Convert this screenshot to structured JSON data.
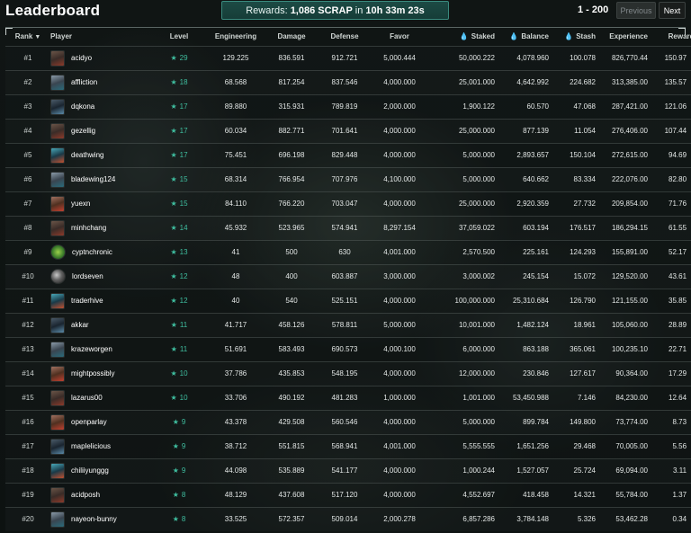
{
  "header": {
    "title": "Leaderboard",
    "rewards_prefix": "Rewards:",
    "rewards_amount": "1,086 SCRAP",
    "rewards_in": "in",
    "rewards_timer": "10h 33m 23s",
    "range": "1 - 200",
    "prev_label": "Previous",
    "next_label": "Next"
  },
  "columns": {
    "rank": "Rank",
    "player": "Player",
    "level": "Level",
    "engineering": "Engineering",
    "damage": "Damage",
    "defense": "Defense",
    "favor": "Favor",
    "staked": "Staked",
    "balance": "Balance",
    "stash": "Stash",
    "experience": "Experience",
    "rewards": "Rewards"
  },
  "icons": {
    "level": "star-icon",
    "token": "droplet-icon",
    "sort": "caret-down-icon"
  },
  "colors": {
    "accent": "#3fbfa0",
    "token": "#4a8ee8",
    "banner": "#1c4a44"
  },
  "rows": [
    {
      "rank": "#1",
      "player": "acidyo",
      "level": "29",
      "engineering": "129.225",
      "damage": "836.591",
      "defense": "912.721",
      "favor": "5,000.444",
      "staked": "50,000.222",
      "balance": "4,078.960",
      "stash": "100.078",
      "experience": "826,770.44",
      "rewards": "150.97"
    },
    {
      "rank": "#2",
      "player": "affliction",
      "level": "18",
      "engineering": "68.568",
      "damage": "817.254",
      "defense": "837.546",
      "favor": "4,000.000",
      "staked": "25,001.000",
      "balance": "4,642.992",
      "stash": "224.682",
      "experience": "313,385.00",
      "rewards": "135.57"
    },
    {
      "rank": "#3",
      "player": "dqkona",
      "level": "17",
      "engineering": "89.880",
      "damage": "315.931",
      "defense": "789.819",
      "favor": "2,000.000",
      "staked": "1,900.122",
      "balance": "60.570",
      "stash": "47.068",
      "experience": "287,421.00",
      "rewards": "121.06"
    },
    {
      "rank": "#4",
      "player": "gezellig",
      "level": "17",
      "engineering": "60.034",
      "damage": "882.771",
      "defense": "701.641",
      "favor": "4,000.000",
      "staked": "25,000.000",
      "balance": "877.139",
      "stash": "11.054",
      "experience": "276,406.00",
      "rewards": "107.44"
    },
    {
      "rank": "#5",
      "player": "deathwing",
      "level": "17",
      "engineering": "75.451",
      "damage": "696.198",
      "defense": "829.448",
      "favor": "4,000.000",
      "staked": "5,000.000",
      "balance": "2,893.657",
      "stash": "150.104",
      "experience": "272,615.00",
      "rewards": "94.69"
    },
    {
      "rank": "#6",
      "player": "bladewing124",
      "level": "15",
      "engineering": "68.314",
      "damage": "766.954",
      "defense": "707.976",
      "favor": "4,100.000",
      "staked": "5,000.000",
      "balance": "640.662",
      "stash": "83.334",
      "experience": "222,076.00",
      "rewards": "82.80"
    },
    {
      "rank": "#7",
      "player": "yuexn",
      "level": "15",
      "engineering": "84.110",
      "damage": "766.220",
      "defense": "703.047",
      "favor": "4,000.000",
      "staked": "25,000.000",
      "balance": "2,920.359",
      "stash": "27.732",
      "experience": "209,854.00",
      "rewards": "71.76"
    },
    {
      "rank": "#8",
      "player": "minhchang",
      "level": "14",
      "engineering": "45.932",
      "damage": "523.965",
      "defense": "574.941",
      "favor": "8,297.154",
      "staked": "37,059.022",
      "balance": "603.194",
      "stash": "176.517",
      "experience": "186,294.15",
      "rewards": "61.55"
    },
    {
      "rank": "#9",
      "player": "cyptnchronic",
      "level": "13",
      "engineering": "41",
      "damage": "500",
      "defense": "630",
      "favor": "4,001.000",
      "staked": "2,570.500",
      "balance": "225.161",
      "stash": "124.293",
      "experience": "155,891.00",
      "rewards": "52.17"
    },
    {
      "rank": "#10",
      "player": "lordseven",
      "level": "12",
      "engineering": "48",
      "damage": "400",
      "defense": "603.887",
      "favor": "3,000.000",
      "staked": "3,000.002",
      "balance": "245.154",
      "stash": "15.072",
      "experience": "129,520.00",
      "rewards": "43.61"
    },
    {
      "rank": "#11",
      "player": "traderhive",
      "level": "12",
      "engineering": "40",
      "damage": "540",
      "defense": "525.151",
      "favor": "4,000.000",
      "staked": "100,000.000",
      "balance": "25,310.684",
      "stash": "126.790",
      "experience": "121,155.00",
      "rewards": "35.85"
    },
    {
      "rank": "#12",
      "player": "akkar",
      "level": "11",
      "engineering": "41.717",
      "damage": "458.126",
      "defense": "578.811",
      "favor": "5,000.000",
      "staked": "10,001.000",
      "balance": "1,482.124",
      "stash": "18.961",
      "experience": "105,060.00",
      "rewards": "28.89"
    },
    {
      "rank": "#13",
      "player": "krazeworgen",
      "level": "11",
      "engineering": "51.691",
      "damage": "583.493",
      "defense": "690.573",
      "favor": "4,000.100",
      "staked": "6,000.000",
      "balance": "863.188",
      "stash": "365.061",
      "experience": "100,235.10",
      "rewards": "22.71"
    },
    {
      "rank": "#14",
      "player": "mightpossibly",
      "level": "10",
      "engineering": "37.786",
      "damage": "435.853",
      "defense": "548.195",
      "favor": "4,000.000",
      "staked": "12,000.000",
      "balance": "230.846",
      "stash": "127.617",
      "experience": "90,364.00",
      "rewards": "17.29"
    },
    {
      "rank": "#15",
      "player": "lazarus00",
      "level": "10",
      "engineering": "33.706",
      "damage": "490.192",
      "defense": "481.283",
      "favor": "1,000.000",
      "staked": "1,001.000",
      "balance": "53,450.988",
      "stash": "7.146",
      "experience": "84,230.00",
      "rewards": "12.64"
    },
    {
      "rank": "#16",
      "player": "openparlay",
      "level": "9",
      "engineering": "43.378",
      "damage": "429.508",
      "defense": "560.546",
      "favor": "4,000.000",
      "staked": "5,000.000",
      "balance": "899.784",
      "stash": "149.800",
      "experience": "73,774.00",
      "rewards": "8.73"
    },
    {
      "rank": "#17",
      "player": "maplelicious",
      "level": "9",
      "engineering": "38.712",
      "damage": "551.815",
      "defense": "568.941",
      "favor": "4,001.000",
      "staked": "5,555.555",
      "balance": "1,651.256",
      "stash": "29.468",
      "experience": "70,005.00",
      "rewards": "5.56"
    },
    {
      "rank": "#18",
      "player": "chiliiyunggg",
      "level": "9",
      "engineering": "44.098",
      "damage": "535.889",
      "defense": "541.177",
      "favor": "4,000.000",
      "staked": "1,000.244",
      "balance": "1,527.057",
      "stash": "25.724",
      "experience": "69,094.00",
      "rewards": "3.11"
    },
    {
      "rank": "#19",
      "player": "acidposh",
      "level": "8",
      "engineering": "48.129",
      "damage": "437.608",
      "defense": "517.120",
      "favor": "4,000.000",
      "staked": "4,552.697",
      "balance": "418.458",
      "stash": "14.321",
      "experience": "55,784.00",
      "rewards": "1.37"
    },
    {
      "rank": "#20",
      "player": "nayeon-bunny",
      "level": "8",
      "engineering": "33.525",
      "damage": "572.357",
      "defense": "509.014",
      "favor": "2,000.278",
      "staked": "6,857.286",
      "balance": "3,784.148",
      "stash": "5.326",
      "experience": "53,462.28",
      "rewards": "0.34"
    }
  ]
}
